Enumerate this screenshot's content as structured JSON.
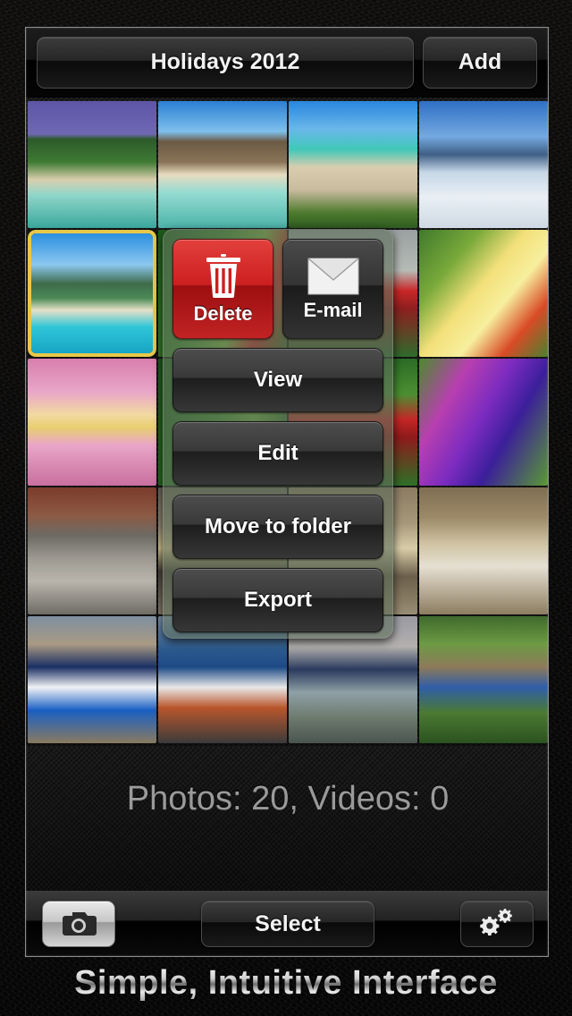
{
  "app": {
    "screen_name": "photo-album-grid"
  },
  "topbar": {
    "album_title": "Holidays 2012",
    "add_label": "Add"
  },
  "grid": {
    "columns": 4,
    "selected_index": 4,
    "thumbnails": [
      {
        "name": "tropical-lagoon-palms",
        "type": "photo"
      },
      {
        "name": "rocky-beach-seychelles",
        "type": "photo"
      },
      {
        "name": "beach-pier-loungers",
        "type": "photo"
      },
      {
        "name": "skiers-snow-slope",
        "type": "photo"
      },
      {
        "name": "island-mountain-aerial",
        "type": "photo",
        "selected": true
      },
      {
        "name": "green-leaf-red-buds",
        "type": "photo"
      },
      {
        "name": "red-berries-blur",
        "type": "photo"
      },
      {
        "name": "yellow-frangipani-flower",
        "type": "photo"
      },
      {
        "name": "pink-daisy-macro",
        "type": "photo"
      },
      {
        "name": "green-foliage",
        "type": "photo"
      },
      {
        "name": "red-flowers-green",
        "type": "photo"
      },
      {
        "name": "purple-pansies",
        "type": "photo"
      },
      {
        "name": "grey-tabby-cat-resting",
        "type": "photo"
      },
      {
        "name": "cat-eye-closeup",
        "type": "photo"
      },
      {
        "name": "cat-face-partial",
        "type": "photo"
      },
      {
        "name": "brown-tabby-cat-portrait",
        "type": "photo"
      },
      {
        "name": "boy-blue-jacket-beach",
        "type": "photo"
      },
      {
        "name": "three-kids-at-seaside-table",
        "type": "photo"
      },
      {
        "name": "boy-behind-wet-glass",
        "type": "photo"
      },
      {
        "name": "family-by-curved-tree",
        "type": "photo"
      }
    ]
  },
  "popup": {
    "delete_label": "Delete",
    "delete_icon": "trash-icon",
    "email_label": "E-mail",
    "email_icon": "envelope-icon",
    "actions": [
      {
        "label": "View"
      },
      {
        "label": "Edit"
      },
      {
        "label": "Move to folder"
      },
      {
        "label": "Export"
      }
    ]
  },
  "status": {
    "counts_label": "Photos: 20, Videos: 0"
  },
  "toolbar": {
    "camera_icon": "camera-icon",
    "select_label": "Select",
    "settings_icon": "gears-icon"
  },
  "caption": {
    "text": "Simple, Intuitive Interface"
  },
  "colors": {
    "delete_red": "#cc1f1f",
    "selection_gold": "#e8c84a",
    "popup_green": "#60705c",
    "chrome_dark": "#141414"
  }
}
